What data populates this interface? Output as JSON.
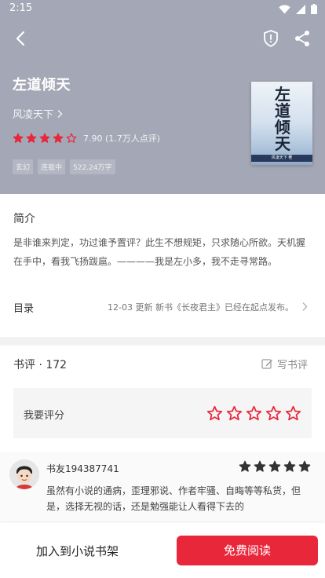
{
  "status": {
    "time": "2:15"
  },
  "book": {
    "title": "左道倾天",
    "author": "风凌天下",
    "rating_value": "7.90",
    "rating_count": "(1.7万人点评)",
    "rating_fraction": 0.8,
    "tags": [
      "玄幻",
      "连载中",
      "522.24万字"
    ],
    "cover_title": "左道倾天",
    "cover_author": "风凌天下 著"
  },
  "intro": {
    "label": "简介",
    "text": "是非谁来判定，功过谁予置评？此生不想规矩，只求随心所欲。天机握在手中，看我飞扬跋扈。————我是左小多，我不走寻常路。"
  },
  "toc": {
    "label": "目录",
    "update": "12-03 更新 新书《长夜君主》已经在起点发布。"
  },
  "reviews": {
    "label": "书评 · 172",
    "write_label": "写书评",
    "my_rating_label": "我要评分",
    "first": {
      "user": "书友194387741",
      "stars": 5,
      "text": "虽然有小说的通病，歪理邪说、作者牢骚、自晦等等私货，但是，选择无视的话，还是勉强能让人看得下去的"
    }
  },
  "bottom": {
    "add_shelf": "加入到小说书架",
    "read": "免费阅读"
  },
  "colors": {
    "accent": "#e8273b",
    "header_bg": "#a4a8b6"
  },
  "icons": [
    "back-icon",
    "report-shield-icon",
    "share-icon",
    "chevron-right-icon",
    "edit-icon",
    "star-icon",
    "wifi-icon",
    "signal-icon",
    "battery-icon"
  ]
}
